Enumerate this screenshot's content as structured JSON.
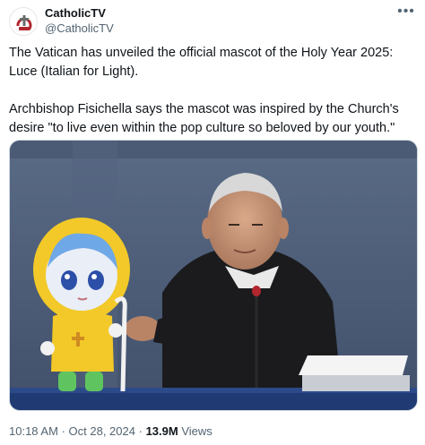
{
  "account": {
    "display_name": "CatholicTV",
    "handle": "@CatholicTV",
    "avatar_icon": "catholictv-logo-icon",
    "more_icon": "more-options-icon"
  },
  "tweet": {
    "paragraph_1": "The Vatican has unveiled the official mascot of the Holy Year 2025: Luce (Italian for Light).",
    "paragraph_2": "Archbishop Fisichella says the mascot was inspired by the Church's desire \"to live even within the pop culture so beloved by our youth.\""
  },
  "meta": {
    "time": "10:18 AM",
    "separator": "·",
    "date": "Oct 28, 2024",
    "views_count": "13.9M",
    "views_label": "Views"
  },
  "colors": {
    "text_primary": "#0f1419",
    "text_secondary": "#536471",
    "border": "#cfd9de"
  }
}
